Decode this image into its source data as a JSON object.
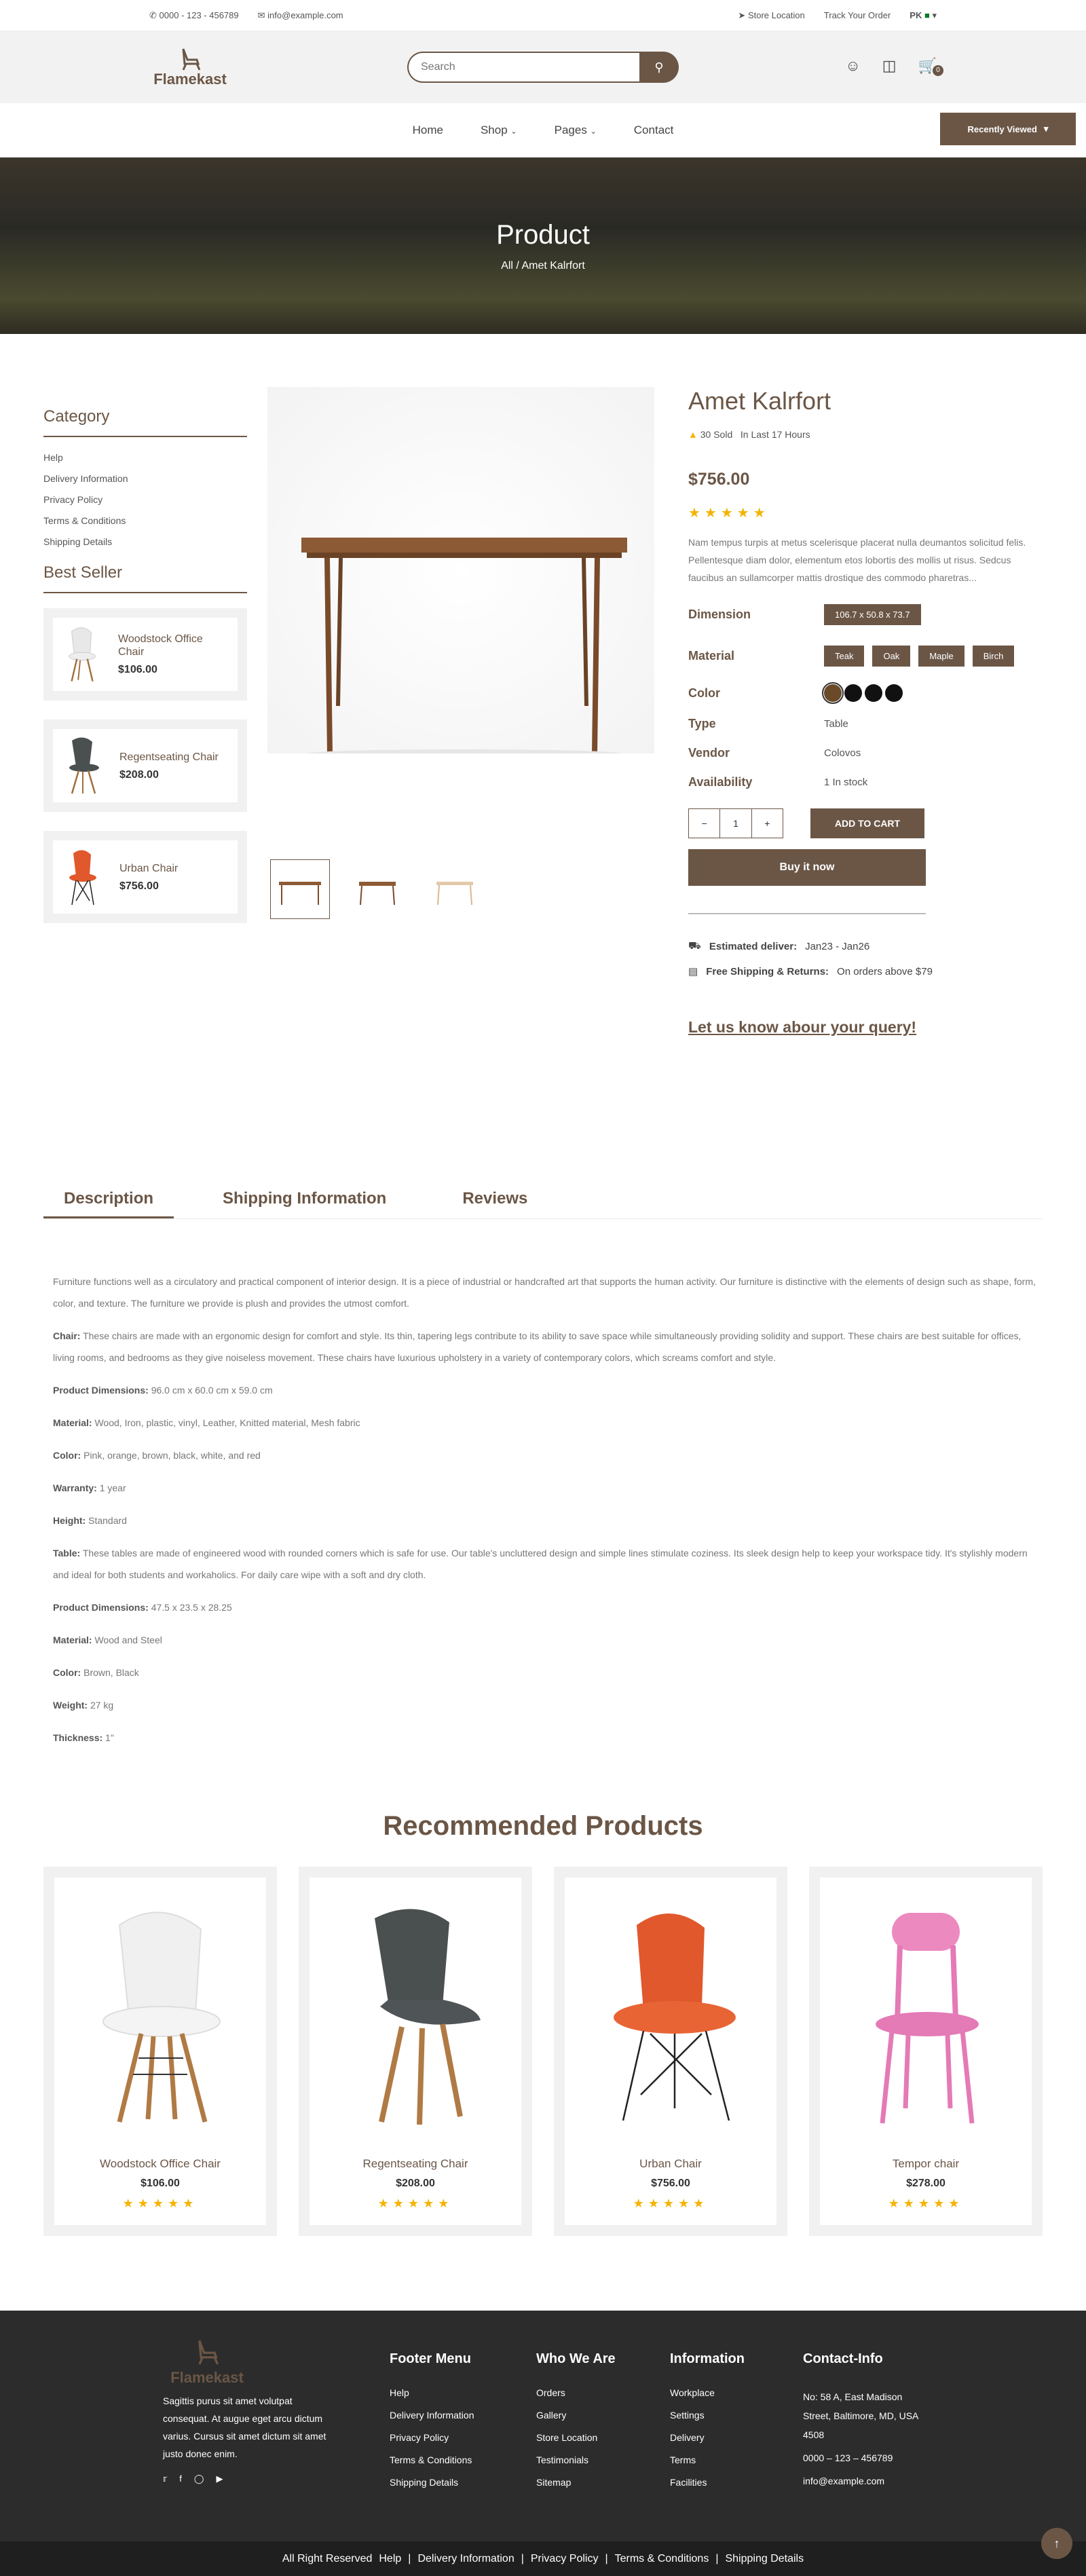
{
  "topbar": {
    "phone": "0000 - 123 - 456789",
    "email": "info@example.com",
    "store": "Store Location",
    "track": "Track Your Order",
    "lang": "PK"
  },
  "header": {
    "brand": "Flamekast",
    "search_placeholder": "Search",
    "cart_count": "0"
  },
  "nav": {
    "home": "Home",
    "shop": "Shop",
    "pages": "Pages",
    "contact": "Contact",
    "recently": "Recently Viewed"
  },
  "banner": {
    "title": "Product",
    "crumb_all": "All",
    "crumb_current": "Amet Kalrfort"
  },
  "sidebar": {
    "category_title": "Category",
    "categories": [
      "Help",
      "Delivery Information",
      "Privacy Policy",
      "Terms & Conditions",
      "Shipping Details"
    ],
    "bestseller_title": "Best Seller",
    "bestsellers": [
      {
        "name": "Woodstock Office Chair",
        "price": "$106.00"
      },
      {
        "name": "Regentseating Chair",
        "price": "$208.00"
      },
      {
        "name": "Urban Chair",
        "price": "$756.00"
      }
    ]
  },
  "product": {
    "title": "Amet Kalrfort",
    "sold": "30 Sold",
    "sold_time": "In Last 17 Hours",
    "price": "$756.00",
    "rating": 5,
    "description": "Nam tempus turpis at metus scelerisque placerat nulla deumantos solicitud felis. Pellentesque diam dolor, elementum etos lobortis des mollis ut risus. Sedcus faucibus an sullamcorper mattis drostique des commodo pharetras...",
    "dimension_label": "Dimension",
    "dimension": "106.7 x 50.8 x 73.7",
    "material_label": "Material",
    "materials": [
      "Teak",
      "Oak",
      "Maple",
      "Birch"
    ],
    "color_label": "Color",
    "colors": [
      "#6b4a2a",
      "#111111",
      "#111111",
      "#111111"
    ],
    "type_label": "Type",
    "type": "Table",
    "vendor_label": "Vendor",
    "vendor": "Colovos",
    "availability_label": "Availability",
    "availability": "1 In stock",
    "qty": "1",
    "add_to_cart": "ADD TO CART",
    "buy_now": "Buy it now",
    "deliver_label": "Estimated deliver:",
    "deliver_value": "Jan23 - Jan26",
    "shipping_label": "Free Shipping & Returns:",
    "shipping_value": "On orders above $79",
    "query": "Let us know abour your query!"
  },
  "tabs": {
    "description": "Description",
    "shipping": "Shipping Information",
    "reviews": "Reviews"
  },
  "tab_content": {
    "intro": "Furniture functions well as a circulatory and practical component of interior design. It is a piece of industrial or handcrafted art that supports the human activity. Our furniture is distinctive with the elements of design such as shape, form, color, and texture. The furniture we provide is plush and provides the utmost comfort.",
    "chair_label": "Chair:",
    "chair_text": "These chairs are made with an ergonomic design for comfort and style. Its thin, tapering legs contribute to its ability to save space while simultaneously providing solidity and support. These chairs are best suitable for offices, living rooms, and bedrooms as they give noiseless movement. These chairs have luxurious upholstery in a variety of contemporary colors, which screams comfort and style.",
    "specs1": [
      {
        "k": "Product Dimensions:",
        "v": "96.0 cm x 60.0 cm x 59.0 cm"
      },
      {
        "k": "Material:",
        "v": "Wood, Iron, plastic, vinyl, Leather, Knitted material, Mesh fabric"
      },
      {
        "k": "Color:",
        "v": "Pink, orange, brown, black, white, and red"
      },
      {
        "k": "Warranty:",
        "v": "1 year"
      },
      {
        "k": "Height:",
        "v": "Standard"
      }
    ],
    "table_label": "Table:",
    "table_text": "These tables are made of engineered wood with rounded corners which is safe for use. Our table's uncluttered design and simple lines stimulate coziness.  Its sleek design help to keep your workspace tidy. It's stylishly modern and ideal for both students and workaholics. For daily care wipe with a soft and dry cloth.",
    "specs2": [
      {
        "k": "Product Dimensions:",
        "v": "47.5 x 23.5 x 28.25"
      },
      {
        "k": "Material:",
        "v": "Wood and Steel"
      },
      {
        "k": "Color:",
        "v": "Brown, Black"
      },
      {
        "k": "Weight:",
        "v": "27 kg"
      },
      {
        "k": "Thickness:",
        "v": "1\""
      }
    ]
  },
  "recommended": {
    "title": "Recommended Products",
    "items": [
      {
        "name": "Woodstock Office Chair",
        "price": "$106.00"
      },
      {
        "name": "Regentseating Chair",
        "price": "$208.00"
      },
      {
        "name": "Urban Chair",
        "price": "$756.00"
      },
      {
        "name": "Tempor chair",
        "price": "$278.00"
      }
    ]
  },
  "footer": {
    "brand": "Flamekast",
    "about": "Sagittis purus sit amet volutpat consequat. At augue eget arcu dictum varius. Cursus sit amet dictum sit amet justo donec enim.",
    "menu_title": "Footer Menu",
    "menu": [
      "Help",
      "Delivery Information",
      "Privacy Policy",
      "Terms & Conditions",
      "Shipping Details"
    ],
    "who_title": "Who We Are",
    "who": [
      "Orders",
      "Gallery",
      "Store Location",
      "Testimonials",
      "Sitemap"
    ],
    "info_title": "Information",
    "info": [
      "Workplace",
      "Settings",
      "Delivery",
      "Terms",
      "Facilities"
    ],
    "contact_title": "Contact-Info",
    "address": "No: 58 A, East Madison Street, Baltimore, MD, USA 4508",
    "phone": "0000 – 123 – 456789",
    "email": "info@example.com",
    "copyright": "All Right Reserved",
    "bottom_links": [
      "Help",
      "Delivery Information",
      "Privacy Policy",
      "Terms & Conditions",
      "Shipping Details"
    ]
  }
}
